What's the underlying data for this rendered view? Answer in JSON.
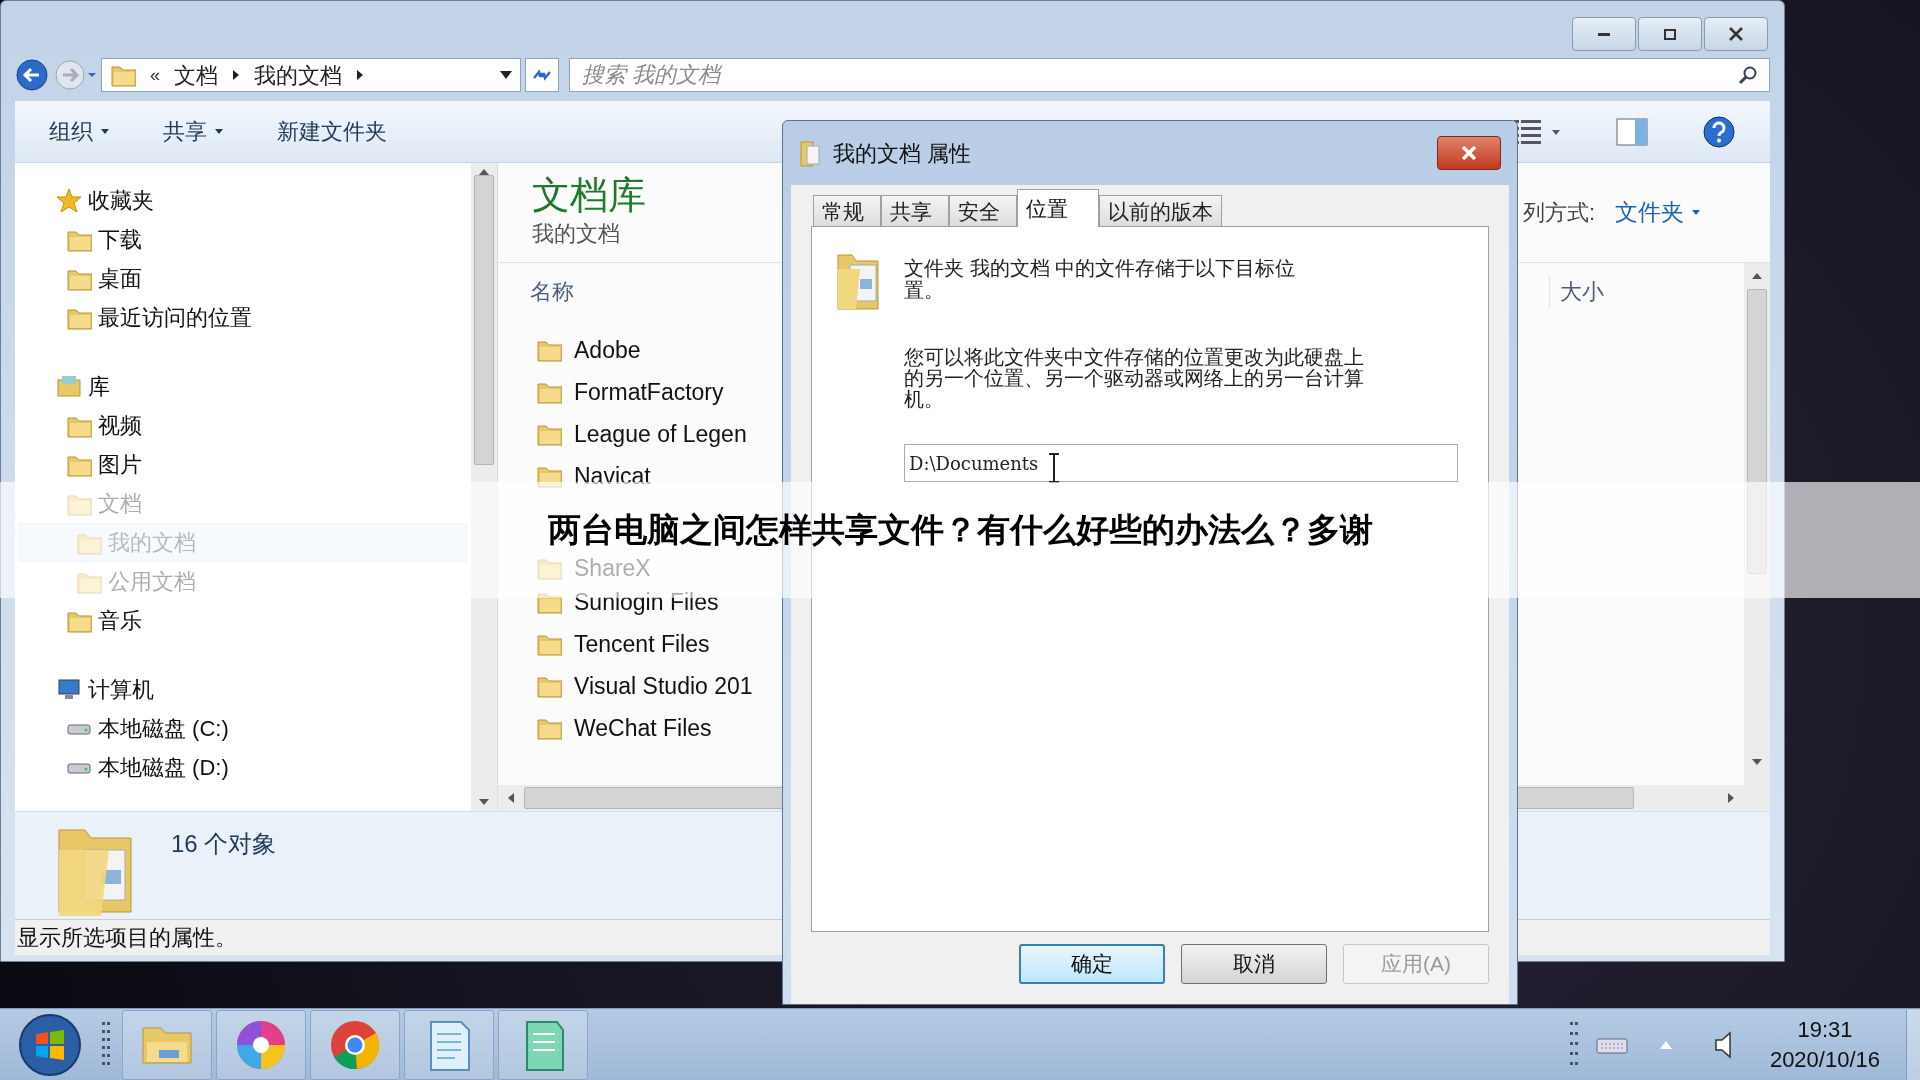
{
  "explorer": {
    "address": {
      "overflow": "«",
      "crumbs": [
        "文档",
        "我的文档"
      ]
    },
    "search": {
      "placeholder": "搜索 我的文档"
    },
    "toolbar": [
      {
        "label": "组织",
        "dropdown": true
      },
      {
        "label": "共享",
        "dropdown": true
      },
      {
        "label": "新建文件夹",
        "dropdown": false
      }
    ],
    "nav": [
      {
        "label": "收藏夹",
        "selected": false,
        "children": [
          {
            "label": "下载",
            "selected": false
          },
          {
            "label": "桌面",
            "selected": false
          },
          {
            "label": "最近访问的位置",
            "selected": false
          }
        ]
      },
      {
        "label": "库",
        "selected": false,
        "children": [
          {
            "label": "视频",
            "selected": false
          },
          {
            "label": "图片",
            "selected": false
          },
          {
            "label": "文档",
            "selected": false,
            "children": [
              {
                "label": "我的文档",
                "selected": true
              },
              {
                "label": "公用文档",
                "selected": false
              }
            ]
          },
          {
            "label": "音乐",
            "selected": false
          }
        ]
      },
      {
        "label": "计算机",
        "selected": false,
        "children": [
          {
            "label": "本地磁盘 (C:)",
            "selected": false
          },
          {
            "label": "本地磁盘 (D:)",
            "selected": false
          }
        ]
      }
    ],
    "library": {
      "title": "文档库",
      "subtitle": "我的文档",
      "arrange_label": "列方式:",
      "arrange_value": "文件夹"
    },
    "columns": [
      "名称",
      "大小"
    ],
    "files": [
      "Adobe",
      "FormatFactory",
      "League of Legen",
      "Navicat",
      "ShareX",
      "Sunlogin Files",
      "Tencent Files",
      "Visual Studio 201",
      "WeChat Files"
    ],
    "details": {
      "count": "16 个对象"
    },
    "status_bar": "显示所选项目的属性。"
  },
  "dialog": {
    "title": "我的文档 属性",
    "tabs": [
      {
        "label": "常规",
        "selected": false
      },
      {
        "label": "共享",
        "selected": false
      },
      {
        "label": "安全",
        "selected": false
      },
      {
        "label": "位置",
        "selected": true
      },
      {
        "label": "以前的版本",
        "selected": false
      }
    ],
    "intro": "文件夹 我的文档 中的文件存储于以下目标位置。",
    "description": "您可以将此文件夹中文件存储的位置更改为此硬盘上的另一个位置、另一个驱动器或网络上的另一台计算机。",
    "path": "D:\\Documents",
    "buttons": [
      {
        "label": "确定",
        "default": true,
        "disabled": false
      },
      {
        "label": "取消",
        "default": false,
        "disabled": false
      },
      {
        "label": "应用(A)",
        "default": false,
        "disabled": true
      }
    ]
  },
  "banner": {
    "text": "两台电脑之间怎样共享文件？有什么好些的办法么？多谢"
  },
  "taskbar": {
    "time": "19:31",
    "date": "2020/10/16"
  }
}
